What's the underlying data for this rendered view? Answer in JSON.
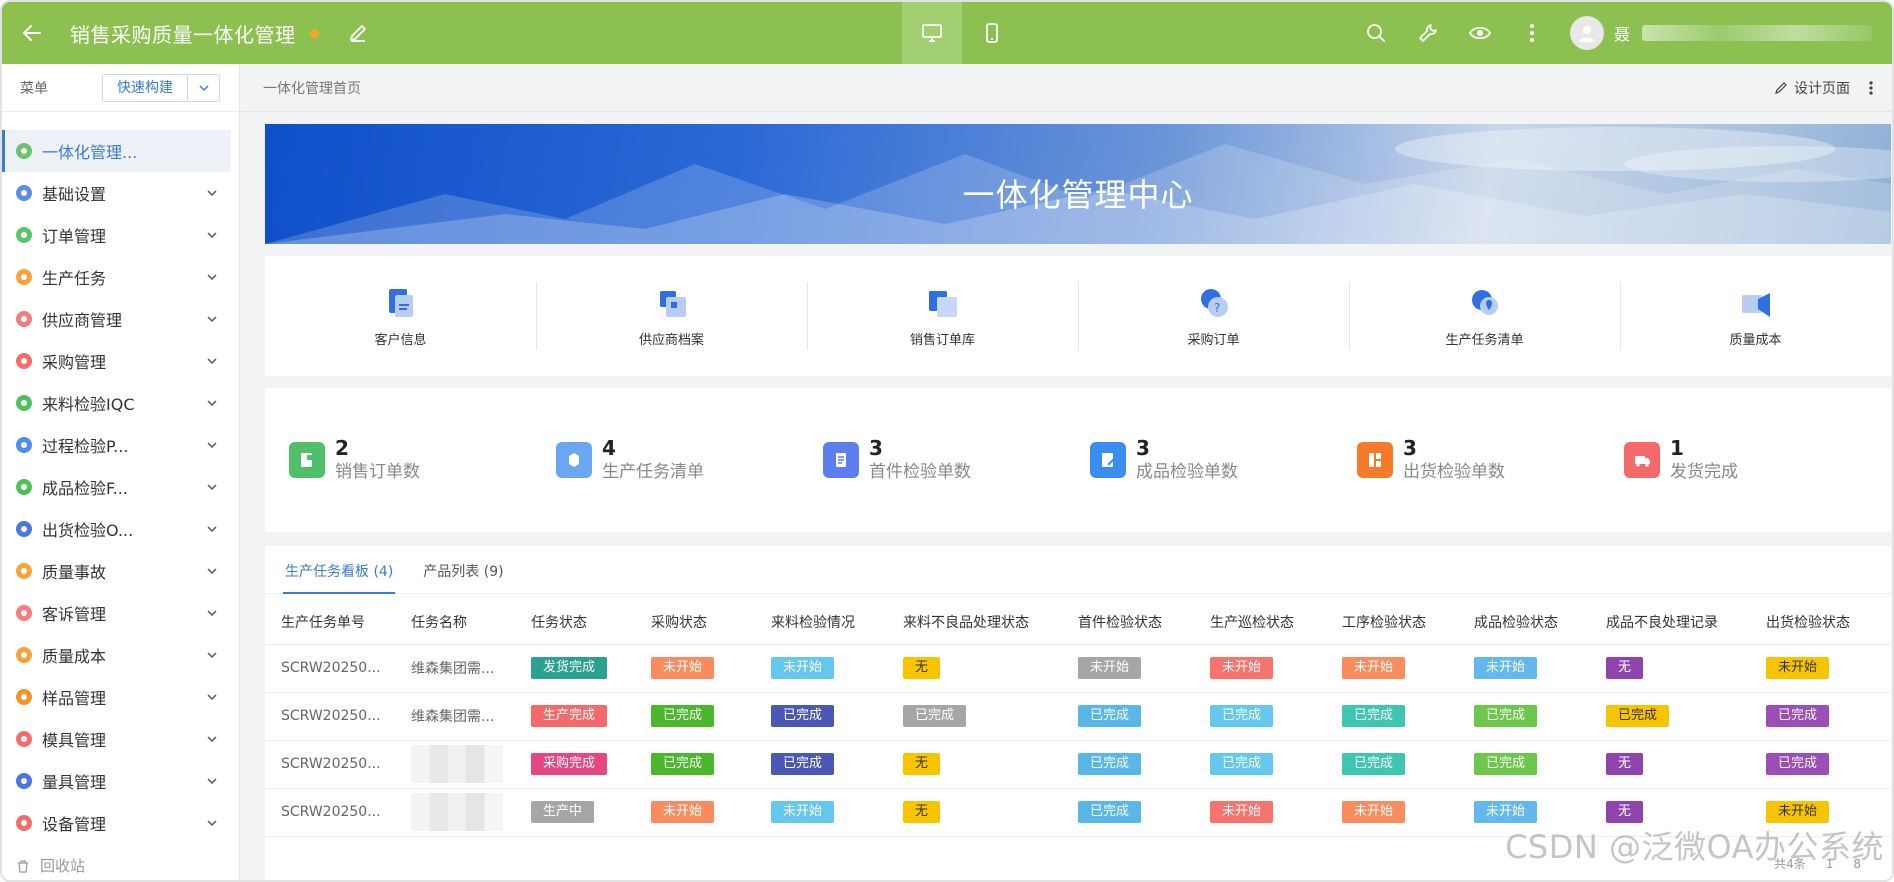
{
  "app": {
    "title": "销售采购质量一体化管理",
    "user_name": "聂"
  },
  "sidebar": {
    "menu_label": "菜单",
    "quick_build": "快速构建",
    "items": [
      {
        "label": "一体化管理...",
        "color": "#6cc36b",
        "active": true
      },
      {
        "label": "基础设置",
        "color": "#5b8def"
      },
      {
        "label": "订单管理",
        "color": "#5cc46c"
      },
      {
        "label": "生产任务",
        "color": "#f7a23b"
      },
      {
        "label": "供应商管理",
        "color": "#f57d7d"
      },
      {
        "label": "采购管理",
        "color": "#f56b6b"
      },
      {
        "label": "来料检验IQC",
        "color": "#4cc25a"
      },
      {
        "label": "过程检验P...",
        "color": "#4d8ef0"
      },
      {
        "label": "成品检验F...",
        "color": "#4cc25a"
      },
      {
        "label": "出货检验O...",
        "color": "#4a74e8"
      },
      {
        "label": "质量事故",
        "color": "#f7a23b"
      },
      {
        "label": "客诉管理",
        "color": "#f57d7d"
      },
      {
        "label": "质量成本",
        "color": "#f7a23b"
      },
      {
        "label": "样品管理",
        "color": "#f7922b"
      },
      {
        "label": "模具管理",
        "color": "#f56b6b"
      },
      {
        "label": "量具管理",
        "color": "#4a74e8"
      },
      {
        "label": "设备管理",
        "color": "#f56b6b"
      }
    ],
    "recycle": "回收站"
  },
  "breadcrumb": {
    "home": "一体化管理首页",
    "design_page": "设计页面"
  },
  "banner": {
    "title": "一体化管理中心"
  },
  "quick_links": [
    {
      "label": "客户信息",
      "icon": "customer-doc-icon"
    },
    {
      "label": "供应商档案",
      "icon": "supplier-file-icon"
    },
    {
      "label": "销售订单库",
      "icon": "sales-order-icon"
    },
    {
      "label": "采购订单",
      "icon": "purchase-order-icon"
    },
    {
      "label": "生产任务清单",
      "icon": "task-list-icon"
    },
    {
      "label": "质量成本",
      "icon": "quality-cost-icon"
    }
  ],
  "stats": [
    {
      "value": "2",
      "label": "销售订单数",
      "color": "#4fbf6a"
    },
    {
      "value": "4",
      "label": "生产任务清单",
      "color": "#6aa6f2"
    },
    {
      "value": "3",
      "label": "首件检验单数",
      "color": "#5b7fef"
    },
    {
      "value": "3",
      "label": "成品检验单数",
      "color": "#3b8df0"
    },
    {
      "value": "3",
      "label": "出货检验单数",
      "color": "#f57b2b"
    },
    {
      "value": "1",
      "label": "发货完成",
      "color": "#f46a6a"
    }
  ],
  "tabs": [
    {
      "label": "生产任务看板 (4)",
      "active": true
    },
    {
      "label": "产品列表 (9)"
    }
  ],
  "table": {
    "headers": [
      "生产任务单号",
      "任务名称",
      "任务状态",
      "采购状态",
      "来料检验情况",
      "来料不良品处理状态",
      "首件检验状态",
      "生产巡检状态",
      "工序检验状态",
      "成品检验状态",
      "成品不良处理记录",
      "出货检验状态"
    ],
    "rows": [
      {
        "id": "SCRW20250...",
        "name": "维森集团需...",
        "cells": [
          {
            "text": "发货完成",
            "color": "#2aa28f"
          },
          {
            "text": "未开始",
            "color": "#f98c5f"
          },
          {
            "text": "未开始",
            "color": "#63c7ee"
          },
          {
            "text": "无",
            "color": "#f8c400",
            "dark": true
          },
          {
            "text": "未开始",
            "color": "#a6a6a6"
          },
          {
            "text": "未开始",
            "color": "#f6736e"
          },
          {
            "text": "未开始",
            "color": "#f98c5f"
          },
          {
            "text": "未开始",
            "color": "#63b9ee"
          },
          {
            "text": "无",
            "color": "#8e44ad"
          },
          {
            "text": "未开始",
            "color": "#f8c400",
            "dark": true
          }
        ]
      },
      {
        "id": "SCRW20250...",
        "name": "维森集团需...",
        "cells": [
          {
            "text": "生产完成",
            "color": "#f46a6a"
          },
          {
            "text": "已完成",
            "color": "#49b82a"
          },
          {
            "text": "已完成",
            "color": "#4a57b5"
          },
          {
            "text": "已完成",
            "color": "#a6a6a6"
          },
          {
            "text": "已完成",
            "color": "#58b7e8"
          },
          {
            "text": "已完成",
            "color": "#63c7ee"
          },
          {
            "text": "已完成",
            "color": "#3ec6b0"
          },
          {
            "text": "已完成",
            "color": "#6cc74a"
          },
          {
            "text": "已完成",
            "color": "#f8c400",
            "dark": true
          },
          {
            "text": "已完成",
            "color": "#9b4db8"
          }
        ]
      },
      {
        "id": "SCRW20250...",
        "name": "",
        "cells": [
          {
            "text": "采购完成",
            "color": "#e54881"
          },
          {
            "text": "已完成",
            "color": "#49b82a"
          },
          {
            "text": "已完成",
            "color": "#4a57b5"
          },
          {
            "text": "无",
            "color": "#f8c400",
            "dark": true
          },
          {
            "text": "已完成",
            "color": "#58b7e8"
          },
          {
            "text": "已完成",
            "color": "#63c7ee"
          },
          {
            "text": "已完成",
            "color": "#3ec6b0"
          },
          {
            "text": "已完成",
            "color": "#6cc74a"
          },
          {
            "text": "无",
            "color": "#8e44ad"
          },
          {
            "text": "已完成",
            "color": "#9b4db8"
          }
        ]
      },
      {
        "id": "SCRW20250...",
        "name": "",
        "cells": [
          {
            "text": "生产中",
            "color": "#a6a6a6"
          },
          {
            "text": "未开始",
            "color": "#f98c5f"
          },
          {
            "text": "未开始",
            "color": "#63c7ee"
          },
          {
            "text": "无",
            "color": "#f8c400",
            "dark": true
          },
          {
            "text": "已完成",
            "color": "#58b7e8"
          },
          {
            "text": "未开始",
            "color": "#f6736e"
          },
          {
            "text": "未开始",
            "color": "#f98c5f"
          },
          {
            "text": "未开始",
            "color": "#63b9ee"
          },
          {
            "text": "无",
            "color": "#8e44ad"
          },
          {
            "text": "未开始",
            "color": "#f8c400",
            "dark": true
          }
        ]
      }
    ],
    "footer_count": "共4条",
    "footer_page": "1",
    "footer_size": "8"
  },
  "watermark": "CSDN @泛微OA办公系统"
}
